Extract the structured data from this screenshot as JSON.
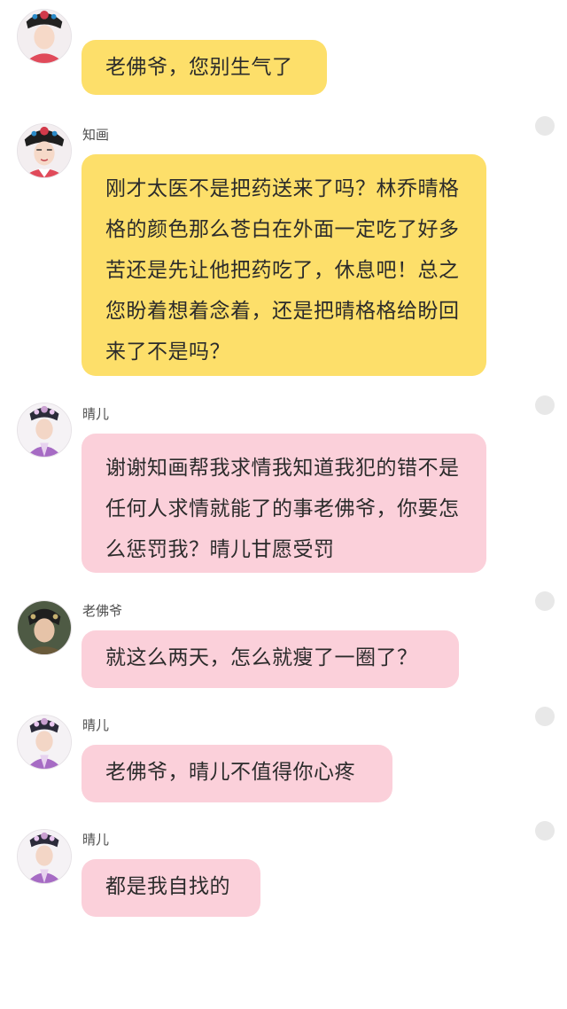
{
  "messages": [
    {
      "sender": "",
      "avatar": "avatar-icon-zhihua",
      "bubble_color": "yellow",
      "text": "老佛爷，您别生气了"
    },
    {
      "sender": "知画",
      "avatar": "avatar-icon-zhihua",
      "bubble_color": "yellow",
      "text": "刚才太医不是把药送来了吗？林乔晴格格的颜色那么苍白在外面一定吃了好多苦还是先让他把药吃了，休息吧！总之您盼着想着念着，还是把晴格格给盼回来了不是吗？"
    },
    {
      "sender": "晴儿",
      "avatar": "avatar-icon-qinger",
      "bubble_color": "pink",
      "text": "谢谢知画帮我求情我知道我犯的错不是任何人求情就能了的事老佛爷，你要怎么惩罚我？晴儿甘愿受罚"
    },
    {
      "sender": "老佛爷",
      "avatar": "avatar-icon-laofoye",
      "bubble_color": "pink",
      "text": "就这么两天，怎么就瘦了一圈了？"
    },
    {
      "sender": "晴儿",
      "avatar": "avatar-icon-qinger",
      "bubble_color": "pink",
      "text": "老佛爷，晴儿不值得你心疼"
    },
    {
      "sender": "晴儿",
      "avatar": "avatar-icon-qinger",
      "bubble_color": "pink",
      "text": "都是我自找的"
    }
  ],
  "colors": {
    "yellow_bubble": "#fddf6a",
    "pink_bubble": "#fbd0da",
    "status_dot": "#e8e8e8"
  }
}
